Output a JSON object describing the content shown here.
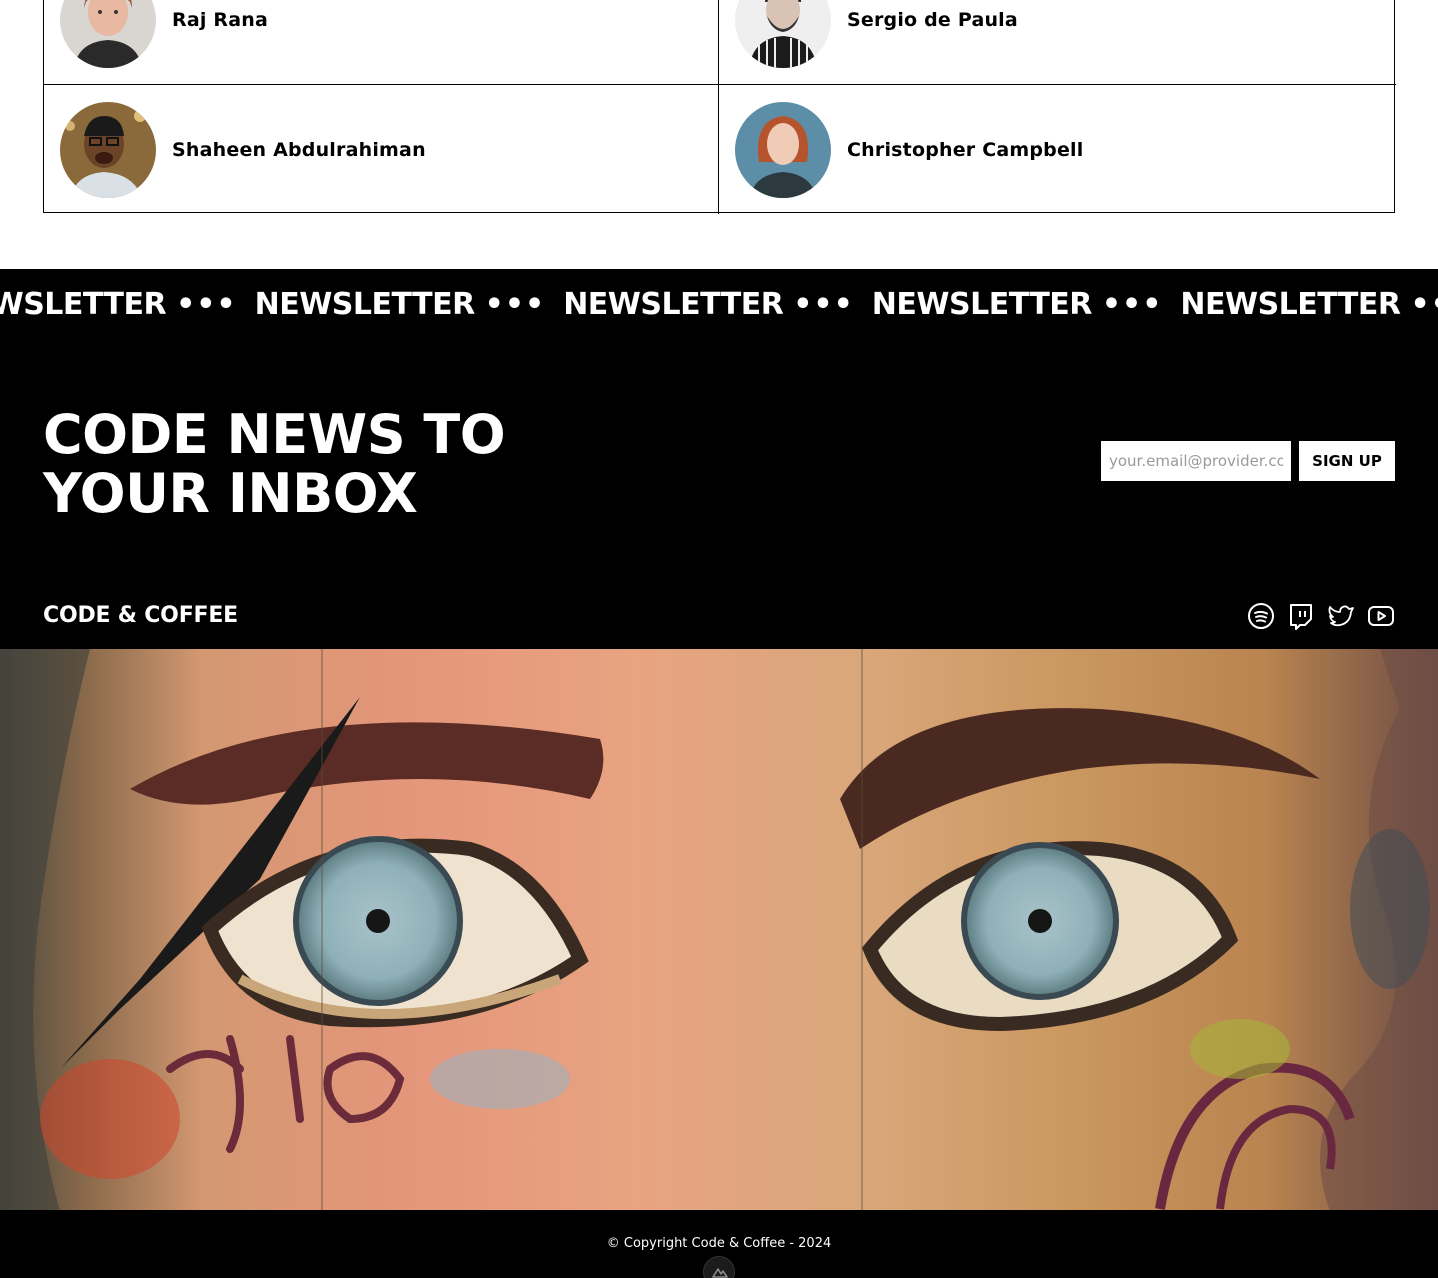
{
  "speakers": [
    {
      "name": "Raj Rana"
    },
    {
      "name": "Sergio de Paula"
    },
    {
      "name": "Shaheen Abdulrahiman"
    },
    {
      "name": "Christopher Campbell"
    }
  ],
  "ticker": {
    "items": [
      "NEWSLETTER",
      "NEWSLETTER",
      "NEWSLETTER",
      "NEWSLETTER",
      "NEWSLETTER",
      "NEWSLETTER"
    ],
    "separator": "•••"
  },
  "newsletter": {
    "headline_line1": "CODE NEWS TO",
    "headline_line2": "YOUR INBOX",
    "email_placeholder": "your.email@provider.com",
    "signup_label": "SIGN UP"
  },
  "brand": "CODE & COFFEE",
  "social_icons": [
    "spotify-icon",
    "twitch-icon",
    "twitter-icon",
    "youtube-icon"
  ],
  "footer": {
    "copyright": "© Copyright Code & Coffee - 2024"
  }
}
